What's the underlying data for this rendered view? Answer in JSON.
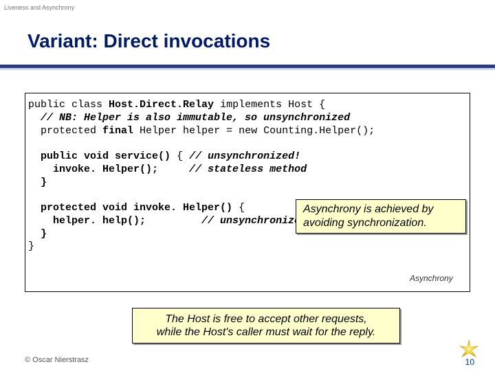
{
  "header": {
    "topic": "Liveness and Asynchrony"
  },
  "title": "Variant: Direct invocations",
  "code": {
    "l1a": "public class ",
    "l1b": "Host.Direct.Relay",
    "l1c": " implements Host {",
    "l2": "  // NB: Helper is also immutable, so unsynchronized",
    "l3a": "  protected ",
    "l3b": "final",
    "l3c": " Helper helper = new Counting.Helper();",
    "l5a": "  public void service()",
    "l5b": " { ",
    "l5c": "// unsynchronized!",
    "l6a": "    invoke. Helper();",
    "l6b": "     ",
    "l6c": "// stateless method",
    "l7": "  }",
    "l9a": "  protected void invoke. Helper()",
    "l9b": " {",
    "l10a": "    helper. help();",
    "l10b": "         ",
    "l10c": "// unsynchronized!",
    "l11": "  }",
    "l12": "}"
  },
  "notes": {
    "n1": "Asynchrony is achieved by avoiding synchronization.",
    "n2a": "The Host is free to accept other requests,",
    "n2b": "while the Host's caller must wait for the reply."
  },
  "package_label": "Asynchrony",
  "footer": {
    "copyright": "© Oscar Nierstrasz",
    "page": "10"
  }
}
